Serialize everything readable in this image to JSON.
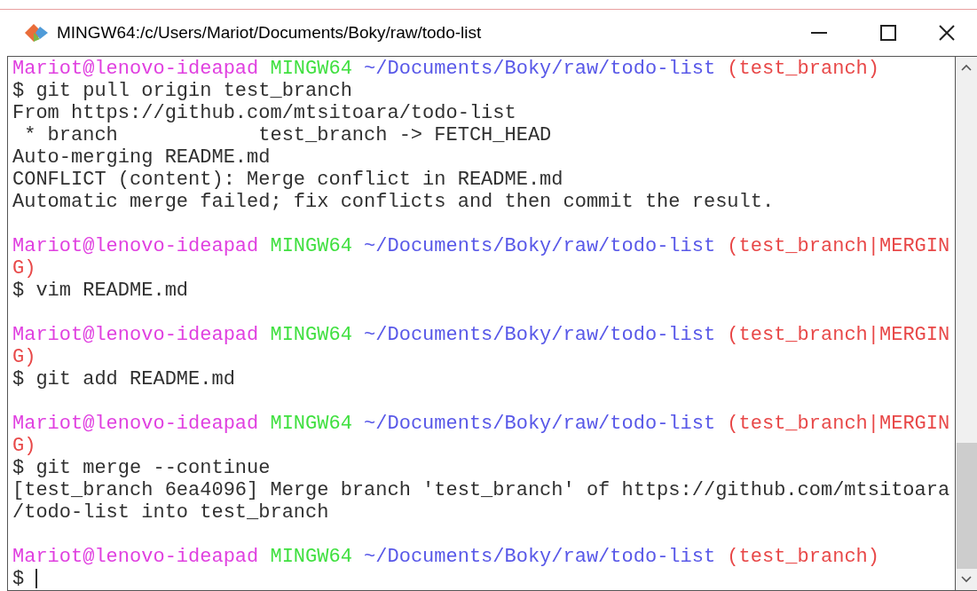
{
  "window": {
    "title": "MINGW64:/c/Users/Mariot/Documents/Boky/raw/todo-list"
  },
  "terminal": {
    "lines": [
      {
        "kind": "text",
        "segments": [
          {
            "text": "Mariot@lenovo-ideapad ",
            "color": "#e040e0"
          },
          {
            "text": "MINGW64 ",
            "color": "#40e040"
          },
          {
            "text": "~/Documents/Boky/raw/todo-list ",
            "color": "#5858e8"
          },
          {
            "text": "(test_branch)",
            "color": "#e84848"
          }
        ]
      },
      {
        "kind": "text",
        "segments": [
          {
            "text": "$ git pull origin test_branch",
            "color": "#303030"
          }
        ]
      },
      {
        "kind": "text",
        "segments": [
          {
            "text": "From https://github.com/mtsitoara/todo-list",
            "color": "#303030"
          }
        ]
      },
      {
        "kind": "text",
        "segments": [
          {
            "text": " * branch            test_branch -> FETCH_HEAD",
            "color": "#303030"
          }
        ]
      },
      {
        "kind": "text",
        "segments": [
          {
            "text": "Auto-merging README.md",
            "color": "#303030"
          }
        ]
      },
      {
        "kind": "text",
        "segments": [
          {
            "text": "CONFLICT (content): Merge conflict in README.md",
            "color": "#303030"
          }
        ]
      },
      {
        "kind": "text",
        "segments": [
          {
            "text": "Automatic merge failed; fix conflicts and then commit the result.",
            "color": "#303030"
          }
        ]
      },
      {
        "kind": "blank"
      },
      {
        "kind": "text",
        "segments": [
          {
            "text": "Mariot@lenovo-ideapad ",
            "color": "#e040e0"
          },
          {
            "text": "MINGW64 ",
            "color": "#40e040"
          },
          {
            "text": "~/Documents/Boky/raw/todo-list ",
            "color": "#5858e8"
          },
          {
            "text": "(test_branch|MERGIN",
            "color": "#e84848"
          }
        ]
      },
      {
        "kind": "text",
        "segments": [
          {
            "text": "G)",
            "color": "#e84848"
          }
        ]
      },
      {
        "kind": "text",
        "segments": [
          {
            "text": "$ vim README.md",
            "color": "#303030"
          }
        ]
      },
      {
        "kind": "blank"
      },
      {
        "kind": "text",
        "segments": [
          {
            "text": "Mariot@lenovo-ideapad ",
            "color": "#e040e0"
          },
          {
            "text": "MINGW64 ",
            "color": "#40e040"
          },
          {
            "text": "~/Documents/Boky/raw/todo-list ",
            "color": "#5858e8"
          },
          {
            "text": "(test_branch|MERGIN",
            "color": "#e84848"
          }
        ]
      },
      {
        "kind": "text",
        "segments": [
          {
            "text": "G)",
            "color": "#e84848"
          }
        ]
      },
      {
        "kind": "text",
        "segments": [
          {
            "text": "$ git add README.md",
            "color": "#303030"
          }
        ]
      },
      {
        "kind": "blank"
      },
      {
        "kind": "text",
        "segments": [
          {
            "text": "Mariot@lenovo-ideapad ",
            "color": "#e040e0"
          },
          {
            "text": "MINGW64 ",
            "color": "#40e040"
          },
          {
            "text": "~/Documents/Boky/raw/todo-list ",
            "color": "#5858e8"
          },
          {
            "text": "(test_branch|MERGIN",
            "color": "#e84848"
          }
        ]
      },
      {
        "kind": "text",
        "segments": [
          {
            "text": "G)",
            "color": "#e84848"
          }
        ]
      },
      {
        "kind": "text",
        "segments": [
          {
            "text": "$ git merge --continue",
            "color": "#303030"
          }
        ]
      },
      {
        "kind": "text",
        "segments": [
          {
            "text": "[test_branch 6ea4096] Merge branch 'test_branch' of https://github.com/mtsitoara",
            "color": "#303030"
          }
        ]
      },
      {
        "kind": "text",
        "segments": [
          {
            "text": "/todo-list into test_branch",
            "color": "#303030"
          }
        ]
      },
      {
        "kind": "blank"
      },
      {
        "kind": "text",
        "segments": [
          {
            "text": "Mariot@lenovo-ideapad ",
            "color": "#e040e0"
          },
          {
            "text": "MINGW64 ",
            "color": "#40e040"
          },
          {
            "text": "~/Documents/Boky/raw/todo-list ",
            "color": "#5858e8"
          },
          {
            "text": "(test_branch)",
            "color": "#e84848"
          }
        ]
      },
      {
        "kind": "text",
        "cursor": true,
        "segments": [
          {
            "text": "$ ",
            "color": "#303030"
          }
        ]
      }
    ]
  }
}
